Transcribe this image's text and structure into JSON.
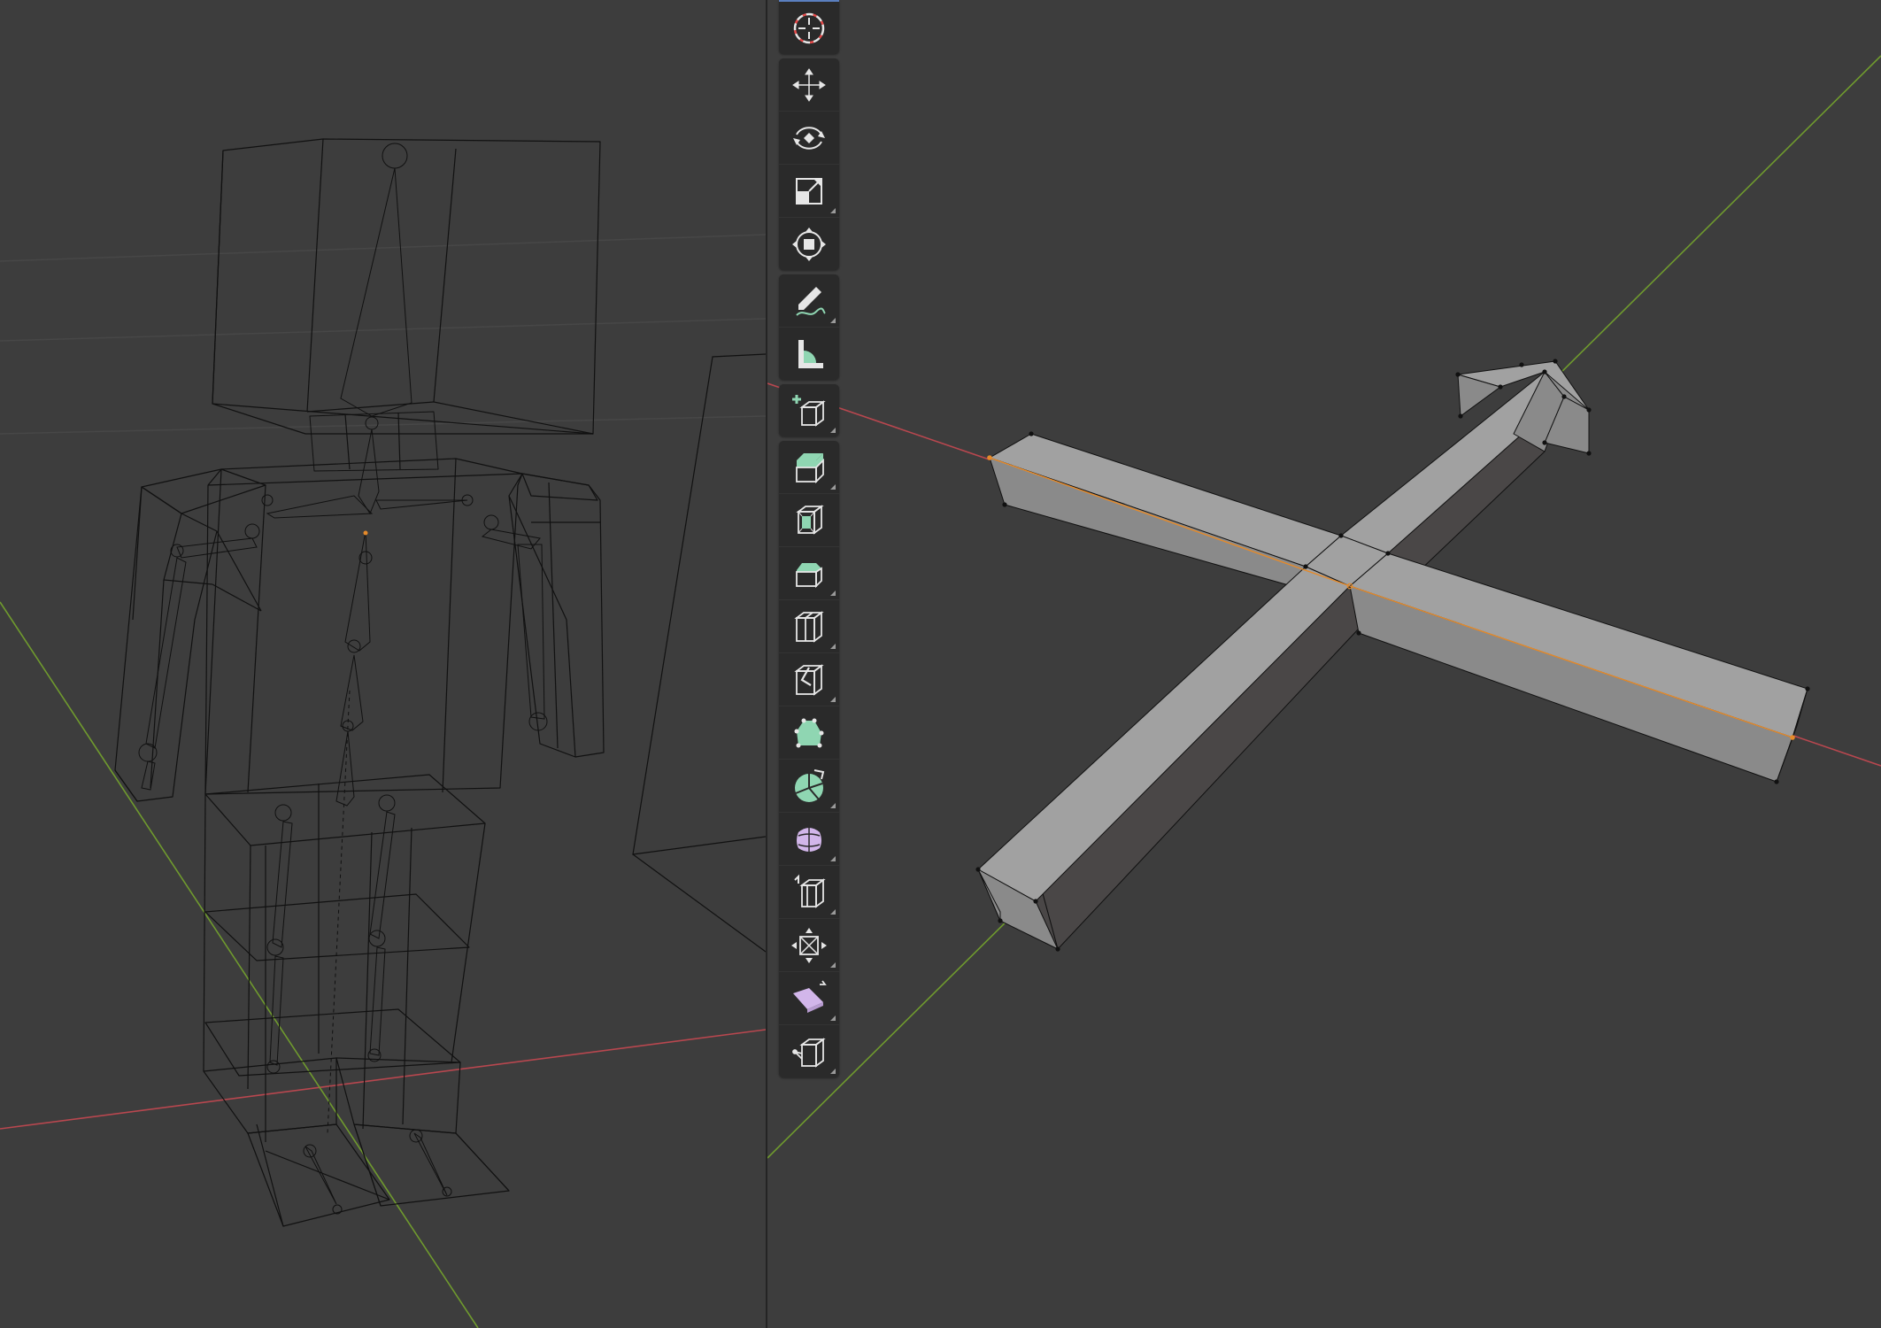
{
  "colors": {
    "viewport_bg": "#3d3d3d",
    "toolbar_bg": "#2a2a2a",
    "x_axis": "#b8474f",
    "y_axis": "#6f9a2e",
    "wire": "#111111",
    "mesh_top": "#9c9c9c",
    "mesh_side_light": "#868686",
    "mesh_side_dark": "#4a4747",
    "selection": "#e58a2a",
    "icon_white": "#e6e6e6",
    "icon_green": "#8fd6b2",
    "icon_lilac": "#d2b6ea"
  },
  "toolbar": {
    "groups": [
      [
        "cursor-icon"
      ],
      [
        "move-icon",
        "rotate-icon",
        "scale-icon",
        "transform-icon"
      ],
      [
        "annotate-icon",
        "measure-icon"
      ],
      [
        "add-cube-icon"
      ],
      [
        "extrude-region-icon",
        "inset-faces-icon",
        "bevel-icon",
        "loop-cut-icon",
        "knife-icon",
        "poly-build-icon",
        "spin-icon",
        "smooth-icon",
        "edge-slide-icon",
        "shrink-fatten-icon",
        "shear-icon",
        "rip-region-icon"
      ]
    ]
  }
}
